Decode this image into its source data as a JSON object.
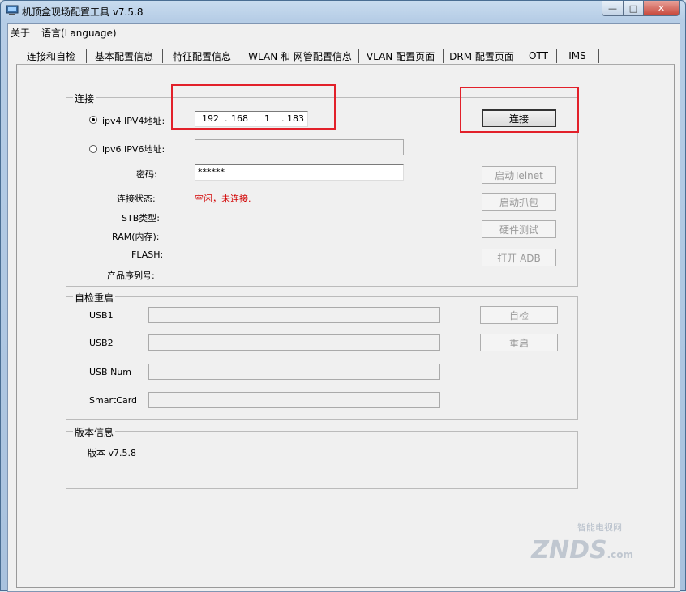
{
  "window": {
    "title": "机顶盒现场配置工具 v7.5.8"
  },
  "menu": [
    {
      "label": "关于"
    },
    {
      "label": "语言(Language)"
    }
  ],
  "tabs": [
    {
      "label": "连接和自检"
    },
    {
      "label": "基本配置信息"
    },
    {
      "label": "特征配置信息"
    },
    {
      "label": "WLAN 和 网管配置信息"
    },
    {
      "label": "VLAN 配置页面"
    },
    {
      "label": "DRM 配置页面"
    },
    {
      "label": "OTT"
    },
    {
      "label": "IMS"
    }
  ],
  "connect": {
    "group_title": "连接",
    "ipv4_label": "ipv4 IPV4地址:",
    "ipv4": [
      "192",
      "168",
      "1",
      "183"
    ],
    "ipv6_label": "ipv6 IPV6地址:",
    "ipv6_value": "",
    "password_label": "密码:",
    "password_value": "******",
    "status_label": "连接状态:",
    "status_value": "空闲，未连接.",
    "stb_type_label": "STB类型:",
    "ram_label": "RAM(内存):",
    "flash_label": "FLASH:",
    "serial_label": "产品序列号:",
    "buttons": {
      "connect": "连接",
      "telnet": "启动Telnet",
      "capture": "启动抓包",
      "hwtest": "硬件测试",
      "adb": "打开 ADB"
    }
  },
  "selfcheck": {
    "group_title": "自检重启",
    "usb1_label": "USB1",
    "usb2_label": "USB2",
    "usbnum_label": "USB Num",
    "smartcard_label": "SmartCard",
    "selfcheck_button": "自检",
    "reboot_button": "重启"
  },
  "version": {
    "group_title": "版本信息",
    "text": "版本 v7.5.8"
  },
  "watermark": {
    "text": "ZNDS",
    "sub": "智能电视网",
    "suffix": ".com"
  },
  "colors": {
    "highlight": "#e2202a",
    "status": "#d20000"
  }
}
